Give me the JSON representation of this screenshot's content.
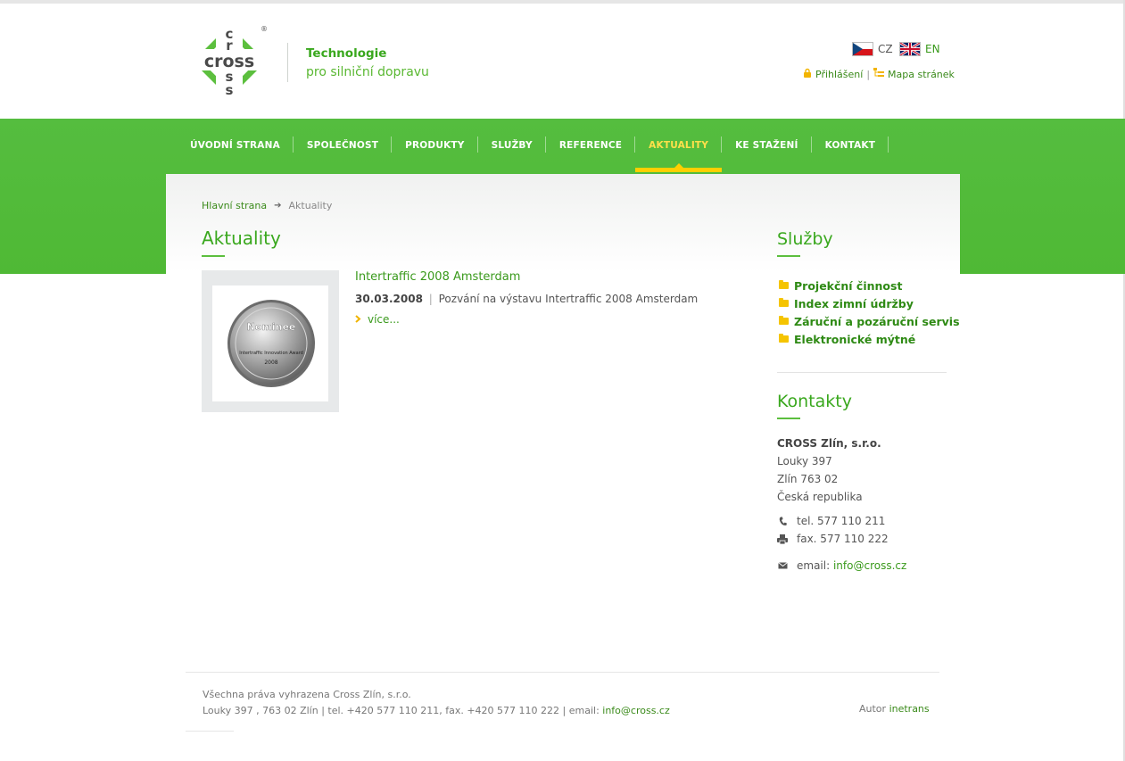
{
  "header": {
    "tagline_line1": "Technologie",
    "tagline_line2": "pro silniční dopravu",
    "logo_registered": "®",
    "logo_letters": "cross",
    "languages": [
      {
        "code": "CZ",
        "active": true
      },
      {
        "code": "EN",
        "active": false
      }
    ],
    "login_label": "Přihlášení",
    "separator": "|",
    "sitemap_label": "Mapa stránek"
  },
  "nav": {
    "items": [
      {
        "label": "ÚVODNÍ STRANA",
        "active": false
      },
      {
        "label": "SPOLEČNOST",
        "active": false
      },
      {
        "label": "PRODUKTY",
        "active": false
      },
      {
        "label": "SLUŽBY",
        "active": false
      },
      {
        "label": "REFERENCE",
        "active": false
      },
      {
        "label": "AKTUALITY",
        "active": true
      },
      {
        "label": "KE STAŽENÍ",
        "active": false
      },
      {
        "label": "KONTAKT",
        "active": false
      }
    ]
  },
  "breadcrumb": {
    "home": "Hlavní strana",
    "arrow": "➔",
    "current": "Aktuality"
  },
  "main": {
    "title": "Aktuality",
    "news": [
      {
        "title": "Intertraffic 2008 Amsterdam",
        "date": "30.03.2008",
        "separator": "|",
        "summary": "Pozvání na výstavu Intertraffic 2008 Amsterdam",
        "more": "více...",
        "badge_text": "Nominee",
        "badge_sub": "Intertraffic Innovation Award",
        "badge_year": "2008"
      }
    ]
  },
  "sidebar": {
    "services_title": "Služby",
    "services": [
      "Projekční činnost",
      "Index zimní údržby",
      "Záruční a pozáruční servis",
      "Elektronické mýtné"
    ],
    "contacts_title": "Kontakty",
    "company": "CROSS Zlín, s.r.o.",
    "street": "Louky 397",
    "city": "Zlín 763 02",
    "country": "Česká republika",
    "tel": "tel. 577 110 211",
    "fax": "fax. 577 110 222",
    "email_label": "email:",
    "email": "info@cross.cz"
  },
  "footer": {
    "line1": "Všechna práva vyhrazena Cross Zlín, s.r.o.",
    "line2_prefix": "Louky 397 , 763 02 Zlín | tel. +420 577 110 211, fax. +420 577 110 222 | email: ",
    "email": "info@cross.cz",
    "author_label": "Autor",
    "author": "inetrans"
  },
  "colors": {
    "brand_green": "#4fb935",
    "accent_yellow": "#ffcf00",
    "link_green": "#3a9a1c"
  }
}
